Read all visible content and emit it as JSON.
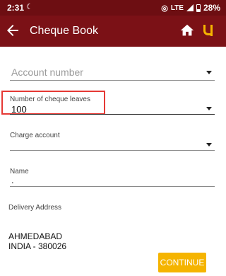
{
  "status_bar": {
    "time": "2:31",
    "network": "LTE",
    "battery": "28%"
  },
  "app_bar": {
    "title": "Cheque Book",
    "back_icon": "arrow-back-icon",
    "home_icon": "home-icon",
    "logo_icon": "bank-logo-icon"
  },
  "form": {
    "account_number": {
      "placeholder": "Account number",
      "value": ""
    },
    "cheque_leaves": {
      "label": "Number of cheque leaves",
      "value": "100"
    },
    "charge_account": {
      "label": "Charge account",
      "value": ""
    },
    "name": {
      "label": "Name",
      "value": "."
    },
    "delivery_address": {
      "label": "Delivery Address",
      "line1": "AHMEDABAD",
      "line2": "INDIA - 380026"
    }
  },
  "actions": {
    "continue_label": "CONTINUE"
  },
  "colors": {
    "app_bar": "#7b1116",
    "status_bar": "#6d0e12",
    "continue_button": "#f5b400",
    "highlight": "#e53935"
  }
}
